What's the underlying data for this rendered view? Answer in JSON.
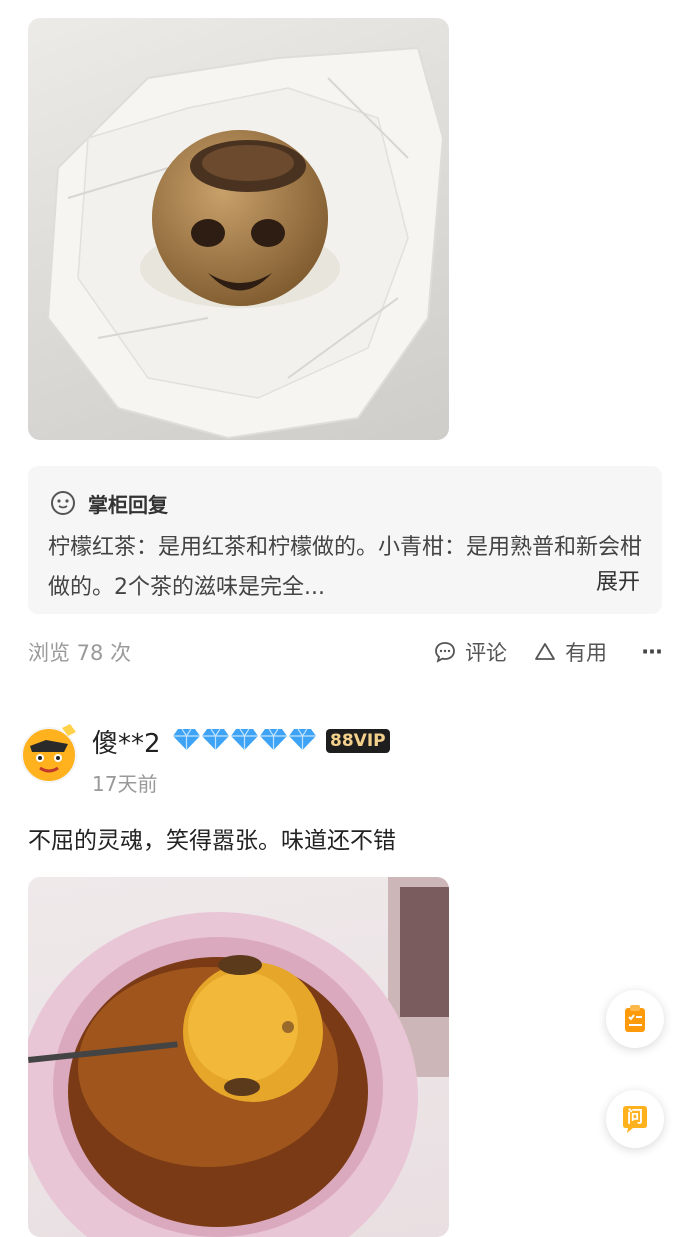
{
  "review1": {
    "photo_alt": "dried citrus tea with carved face on tissue paper",
    "reply_title": "掌柜回复",
    "reply_text": "柠檬红茶：是用红茶和柠檬做的。小青柑：是用熟普和新会柑做的。2个茶的滋味是完全...",
    "expand_label": "展开",
    "views_label": "浏览 78 次",
    "comment_label": "评论",
    "useful_label": "有用",
    "more_label": "···"
  },
  "review2": {
    "username": "傻**2",
    "diamond_count": 5,
    "vip_badge": "88VIP",
    "time": "17天前",
    "comment": "不屈的灵魂，笑得嚣张。味道还不错"
  },
  "fab": {
    "list_icon": "clipboard-list-icon",
    "ask_label": "问"
  },
  "colors": {
    "diamond": "#3fa3f5",
    "fab_accent": "#ff9a0a",
    "vip_bg": "#1e1e1e",
    "vip_text": "#f3d08b"
  }
}
